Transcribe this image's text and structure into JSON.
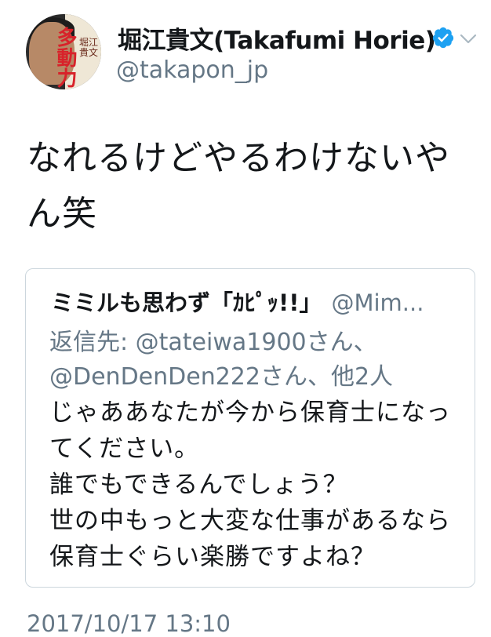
{
  "author": {
    "display_name": "堀江貴文(Takafumi Horie)",
    "handle": "@takapon_jp",
    "verified_icon": "verified-badge-icon",
    "menu_icon": "chevron-down-icon",
    "avatar_text": "多動力",
    "avatar_small_text": "堀江\n貴文",
    "verified_color": "#1da1f2"
  },
  "tweet": {
    "text": "なれるけどやるわけないやん笑",
    "timestamp": "2017/10/17 13:10"
  },
  "quoted_tweet": {
    "display_name": "ミミルも思わず「ｶﾋﾟｯ!!」",
    "handle": "@Mim...",
    "reply_to": "返信先: @tateiwa1900さん、@DenDenDen222さん、他2人",
    "text": "じゃああなたが今から保育士になってください。\n誰でもできるんでしょう？\n世の中もっと大変な仕事があるなら保育士ぐらい楽勝ですよね？"
  }
}
